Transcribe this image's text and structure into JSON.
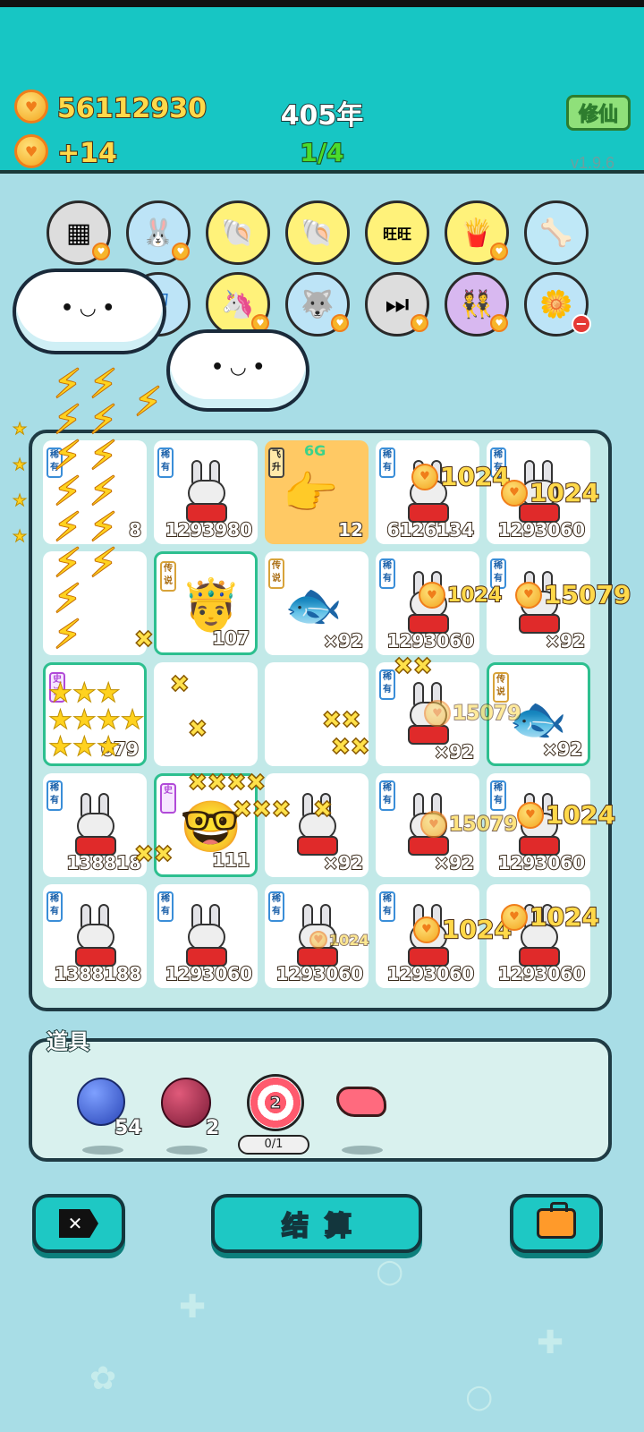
{
  "header": {
    "coins": "56112930",
    "rate": "+14",
    "year": "405年",
    "stage": "1/4",
    "cultivate_button": "修仙",
    "version": "v1.9.6"
  },
  "icons": {
    "row1": [
      "sugar-cubes-icon",
      "bunny-icon",
      "shell-icon",
      "shell-icon",
      "wang-tiles-icon",
      "fries-icon",
      "dog-bowl-icon"
    ],
    "row2": [
      "shield-icon",
      "unicorn-icon",
      "husky-icon",
      "skip-icon",
      "twins-icon",
      "flower-pot-icon"
    ]
  },
  "board": {
    "cells": [
      {
        "tag": "稀有",
        "value": "8"
      },
      {
        "tag": "稀有",
        "value": "1293980"
      },
      {
        "tag": "飞升",
        "badge": "6G",
        "value": "12"
      },
      {
        "tag": "稀有",
        "value": "6126134"
      },
      {
        "tag": "稀有",
        "value": "1293060"
      },
      {
        "tag": "",
        "value": ""
      },
      {
        "tag": "传说",
        "value": "107"
      },
      {
        "tag": "传说",
        "value": "×92"
      },
      {
        "tag": "稀有",
        "value": "1293060"
      },
      {
        "tag": "稀有",
        "value": "×92"
      },
      {
        "tag": "史诗",
        "value": "079"
      },
      {
        "tag": "",
        "value": ""
      },
      {
        "tag": "",
        "value": ""
      },
      {
        "tag": "稀有",
        "value": "×92"
      },
      {
        "tag": "传说",
        "value": "×92"
      },
      {
        "tag": "稀有",
        "value": "138818"
      },
      {
        "tag": "史",
        "value": "111"
      },
      {
        "tag": "",
        "value": "×92"
      },
      {
        "tag": "稀有",
        "value": "×92"
      },
      {
        "tag": "稀有",
        "value": "1293060"
      },
      {
        "tag": "稀有",
        "value": "1388188"
      },
      {
        "tag": "稀有",
        "value": "1293060"
      },
      {
        "tag": "稀有",
        "value": "1293060"
      },
      {
        "tag": "稀有",
        "value": "1293060"
      },
      {
        "tag": "",
        "value": "1293060"
      }
    ],
    "floating": {
      "f1": "1024",
      "f2": "1024",
      "f3": "1024",
      "f4": "15079",
      "f5": "15079",
      "f6": "15079",
      "f7": "1024",
      "f8": "1024",
      "f9": "1024",
      "f10": "1024"
    }
  },
  "props": {
    "title": "道具",
    "blueberry_count": "54",
    "lychee_count": "2",
    "target_number": "2",
    "target_progress": "0/1"
  },
  "actions": {
    "settle_label": "结算"
  }
}
